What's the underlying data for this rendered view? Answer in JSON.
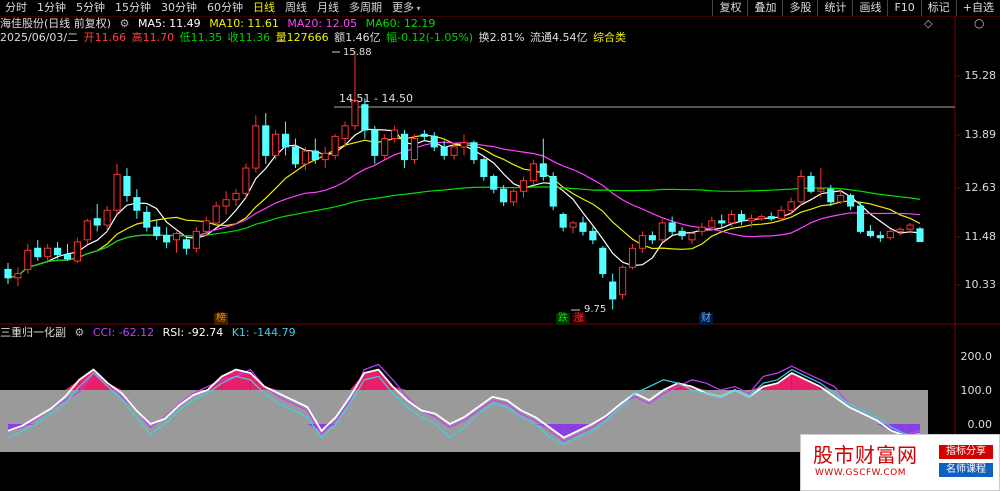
{
  "toolbar": {
    "period_tabs": [
      "分时",
      "1分钟",
      "5分钟",
      "15分钟",
      "30分钟",
      "60分钟",
      "日线",
      "周线",
      "月线",
      "多周期",
      "更多"
    ],
    "active_tab": "日线",
    "right_buttons": [
      "复权",
      "叠加",
      "多股",
      "统计",
      "画线",
      "F10",
      "标记",
      "+自选"
    ]
  },
  "header": {
    "stock_title": "海佳股份(日线 前复权)",
    "ma_labels": [
      {
        "text": "MA5: 11.49",
        "color": "#ffffff"
      },
      {
        "text": "MA10: 11.61",
        "color": "#f0f000"
      },
      {
        "text": "MA20: 12.05",
        "color": "#ff40ff"
      },
      {
        "text": "MA60: 12.19",
        "color": "#00e000"
      }
    ],
    "date": "2025/06/03/二",
    "ohlc": [
      {
        "text": "开11.66",
        "color": "#ff4040"
      },
      {
        "text": "高11.70",
        "color": "#ff4040"
      },
      {
        "text": "低11.35",
        "color": "#00d000"
      },
      {
        "text": "收11.36",
        "color": "#00d000"
      },
      {
        "text": "量127666",
        "color": "#f0f000"
      },
      {
        "text": "额1.46亿",
        "color": "#dddddd"
      },
      {
        "text": "幅-0.12(-1.05%)",
        "color": "#00d000"
      },
      {
        "text": "换2.81%",
        "color": "#dddddd"
      },
      {
        "text": "流通4.54亿",
        "color": "#dddddd"
      },
      {
        "text": "综合类",
        "color": "#f0f000"
      }
    ]
  },
  "price_axis": [
    "15.28",
    "13.89",
    "12.63",
    "11.48",
    "10.33"
  ],
  "annotations": {
    "high": "15.88",
    "range": "14.51 - 14.50",
    "low": "9.75",
    "badges": [
      {
        "text": "榜",
        "color": "#ff8c00",
        "bg": "#3a2200"
      },
      {
        "text": "跌",
        "color": "#00e000",
        "bg": "#003300"
      },
      {
        "text": "涨",
        "color": "#ff3030",
        "bg": "#400000"
      },
      {
        "text": "财",
        "color": "#6aa8ff",
        "bg": "#001a40"
      }
    ]
  },
  "sub_indicator": {
    "title": "三重归一化副",
    "labels": [
      {
        "text": "CCI: -62.12",
        "color": "#c040ff"
      },
      {
        "text": "RSI: -92.74",
        "color": "#ffffff"
      },
      {
        "text": "K1: -144.79",
        "color": "#40d0e0"
      }
    ],
    "axis": [
      "200.0",
      "100.0",
      "0.00"
    ]
  },
  "watermark": {
    "title": "股市财富网",
    "url": "WWW.GSCFW.COM",
    "tag1": "指标分享",
    "tag2": "名师课程"
  },
  "chart_data": [
    {
      "type": "candlestick",
      "title": "",
      "ylim": [
        9.6,
        16.2
      ],
      "price_ticks": [
        15.28,
        13.89,
        12.63,
        11.48,
        10.33
      ],
      "ohlc": [
        [
          10.7,
          10.85,
          10.35,
          10.5
        ],
        [
          10.5,
          10.75,
          10.3,
          10.6
        ],
        [
          10.7,
          11.3,
          10.6,
          11.15
        ],
        [
          11.2,
          11.4,
          10.9,
          11.0
        ],
        [
          11.0,
          11.3,
          10.85,
          11.2
        ],
        [
          11.2,
          11.35,
          10.95,
          11.05
        ],
        [
          11.05,
          11.3,
          10.9,
          10.95
        ],
        [
          10.9,
          11.45,
          10.85,
          11.35
        ],
        [
          11.4,
          11.9,
          11.3,
          11.85
        ],
        [
          11.9,
          12.25,
          11.6,
          11.75
        ],
        [
          11.75,
          12.2,
          11.6,
          12.1
        ],
        [
          12.1,
          13.2,
          12.0,
          12.95
        ],
        [
          12.9,
          13.1,
          12.3,
          12.45
        ],
        [
          12.4,
          12.6,
          11.9,
          12.1
        ],
        [
          12.05,
          12.2,
          11.6,
          11.7
        ],
        [
          11.7,
          11.85,
          11.4,
          11.5
        ],
        [
          11.5,
          11.7,
          11.2,
          11.35
        ],
        [
          11.4,
          11.6,
          11.1,
          11.55
        ],
        [
          11.4,
          11.5,
          11.05,
          11.2
        ],
        [
          11.2,
          11.7,
          11.1,
          11.6
        ],
        [
          11.6,
          11.95,
          11.5,
          11.85
        ],
        [
          11.8,
          12.3,
          11.75,
          12.2
        ],
        [
          12.2,
          12.55,
          12.0,
          12.35
        ],
        [
          12.35,
          12.6,
          12.2,
          12.5
        ],
        [
          12.5,
          13.2,
          12.4,
          13.1
        ],
        [
          13.1,
          14.35,
          13.0,
          14.1
        ],
        [
          14.1,
          14.4,
          13.2,
          13.4
        ],
        [
          13.4,
          14.0,
          13.3,
          13.9
        ],
        [
          13.9,
          14.2,
          13.4,
          13.6
        ],
        [
          13.6,
          13.8,
          13.1,
          13.2
        ],
        [
          13.2,
          13.6,
          13.05,
          13.5
        ],
        [
          13.5,
          13.8,
          13.2,
          13.3
        ],
        [
          13.3,
          13.6,
          13.1,
          13.45
        ],
        [
          13.4,
          13.9,
          13.3,
          13.85
        ],
        [
          13.8,
          14.2,
          13.6,
          14.1
        ],
        [
          14.1,
          15.88,
          14.0,
          14.7
        ],
        [
          14.6,
          14.75,
          13.8,
          14.0
        ],
        [
          14.0,
          14.1,
          13.2,
          13.4
        ],
        [
          13.4,
          13.9,
          13.3,
          13.8
        ],
        [
          13.8,
          14.1,
          13.7,
          14.0
        ],
        [
          13.9,
          14.0,
          13.1,
          13.3
        ],
        [
          13.3,
          13.9,
          13.2,
          13.8
        ],
        [
          13.9,
          14.0,
          13.75,
          13.85
        ],
        [
          13.85,
          13.95,
          13.5,
          13.6
        ],
        [
          13.6,
          13.75,
          13.3,
          13.4
        ],
        [
          13.4,
          13.7,
          13.3,
          13.6
        ],
        [
          13.6,
          13.9,
          13.4,
          13.7
        ],
        [
          13.7,
          13.75,
          13.2,
          13.3
        ],
        [
          13.3,
          13.35,
          12.8,
          12.9
        ],
        [
          12.9,
          12.95,
          12.5,
          12.6
        ],
        [
          12.6,
          12.7,
          12.2,
          12.3
        ],
        [
          12.3,
          12.6,
          12.2,
          12.55
        ],
        [
          12.55,
          12.9,
          12.4,
          12.8
        ],
        [
          12.8,
          13.3,
          12.7,
          13.2
        ],
        [
          13.2,
          13.8,
          12.8,
          12.9
        ],
        [
          12.9,
          13.0,
          12.1,
          12.2
        ],
        [
          12.0,
          12.05,
          11.6,
          11.7
        ],
        [
          11.7,
          11.85,
          11.55,
          11.8
        ],
        [
          11.8,
          11.95,
          11.5,
          11.6
        ],
        [
          11.6,
          11.7,
          11.3,
          11.4
        ],
        [
          11.2,
          11.25,
          10.5,
          10.6
        ],
        [
          10.4,
          10.6,
          9.75,
          10.0
        ],
        [
          10.1,
          10.8,
          10.0,
          10.75
        ],
        [
          10.75,
          11.3,
          10.7,
          11.2
        ],
        [
          11.2,
          11.6,
          11.1,
          11.5
        ],
        [
          11.5,
          11.6,
          11.3,
          11.4
        ],
        [
          11.4,
          11.9,
          11.35,
          11.8
        ],
        [
          11.8,
          11.95,
          11.5,
          11.6
        ],
        [
          11.6,
          11.7,
          11.4,
          11.5
        ],
        [
          11.4,
          11.6,
          11.3,
          11.55
        ],
        [
          11.6,
          11.8,
          11.5,
          11.7
        ],
        [
          11.7,
          11.95,
          11.6,
          11.85
        ],
        [
          11.85,
          12.0,
          11.7,
          11.8
        ],
        [
          11.8,
          12.1,
          11.7,
          12.0
        ],
        [
          12.0,
          12.1,
          11.75,
          11.85
        ],
        [
          11.85,
          12.0,
          11.7,
          11.9
        ],
        [
          11.9,
          12.0,
          11.85,
          11.95
        ],
        [
          11.95,
          12.05,
          11.85,
          11.9
        ],
        [
          11.9,
          12.2,
          11.85,
          12.1
        ],
        [
          12.1,
          12.4,
          12.0,
          12.3
        ],
        [
          12.3,
          13.05,
          12.2,
          12.9
        ],
        [
          12.9,
          13.0,
          12.5,
          12.55
        ],
        [
          12.55,
          13.1,
          12.4,
          12.6
        ],
        [
          12.6,
          12.7,
          12.2,
          12.3
        ],
        [
          12.3,
          12.6,
          12.25,
          12.45
        ],
        [
          12.45,
          12.5,
          12.1,
          12.2
        ],
        [
          12.2,
          12.3,
          11.55,
          11.6
        ],
        [
          11.6,
          11.75,
          11.45,
          11.5
        ],
        [
          11.5,
          11.6,
          11.35,
          11.45
        ],
        [
          11.45,
          11.65,
          11.4,
          11.6
        ],
        [
          11.6,
          11.7,
          11.5,
          11.65
        ],
        [
          11.65,
          11.8,
          11.55,
          11.75
        ],
        [
          11.66,
          11.7,
          11.35,
          11.36
        ]
      ],
      "ma_series": [
        {
          "name": "MA5",
          "color": "#ffffff"
        },
        {
          "name": "MA10",
          "color": "#f0f000"
        },
        {
          "name": "MA20",
          "color": "#ff40ff"
        },
        {
          "name": "MA60",
          "color": "#00e000"
        }
      ]
    },
    {
      "type": "line",
      "title": "三重归一化副",
      "ylim": [
        -60,
        230
      ],
      "y_ticks": [
        200,
        100,
        0
      ],
      "gray_band": [
        0,
        100
      ],
      "series": [
        {
          "name": "CCI",
          "color": "#c040ff",
          "values": [
            -20,
            -10,
            15,
            45,
            70,
            95,
            150,
            120,
            80,
            40,
            -10,
            20,
            60,
            90,
            110,
            130,
            140,
            160,
            110,
            80,
            60,
            40,
            -30,
            10,
            70,
            160,
            175,
            130,
            80,
            40,
            20,
            -10,
            10,
            40,
            70,
            60,
            30,
            10,
            -20,
            -50,
            -30,
            -10,
            20,
            60,
            80,
            60,
            90,
            110,
            130,
            120,
            100,
            110,
            90,
            140,
            150,
            170,
            150,
            130,
            110,
            60,
            40,
            20,
            -10,
            -30,
            -20
          ]
        },
        {
          "name": "RSI",
          "color": "#ffffff",
          "values": [
            -20,
            -5,
            20,
            45,
            80,
            130,
            160,
            120,
            90,
            40,
            0,
            15,
            55,
            85,
            100,
            140,
            160,
            150,
            110,
            90,
            70,
            50,
            -20,
            20,
            80,
            150,
            160,
            110,
            70,
            40,
            30,
            0,
            20,
            50,
            80,
            70,
            40,
            20,
            -10,
            -40,
            -20,
            0,
            25,
            60,
            90,
            70,
            100,
            120,
            110,
            90,
            80,
            100,
            80,
            110,
            120,
            150,
            130,
            110,
            80,
            50,
            30,
            10,
            -20,
            -35,
            -30
          ]
        },
        {
          "name": "K1",
          "color": "#40d0e0",
          "values": [
            -40,
            -20,
            0,
            30,
            60,
            110,
            150,
            110,
            70,
            20,
            -30,
            0,
            40,
            70,
            90,
            120,
            140,
            130,
            90,
            60,
            40,
            20,
            -40,
            0,
            60,
            130,
            140,
            90,
            50,
            20,
            0,
            -40,
            -10,
            30,
            60,
            50,
            20,
            0,
            -40,
            -60,
            -40,
            -20,
            10,
            50,
            90,
            110,
            130,
            120,
            100,
            90,
            80,
            100,
            80,
            120,
            130,
            160,
            140,
            120,
            90,
            60,
            40,
            20,
            -10,
            -30,
            -40
          ]
        }
      ]
    }
  ]
}
